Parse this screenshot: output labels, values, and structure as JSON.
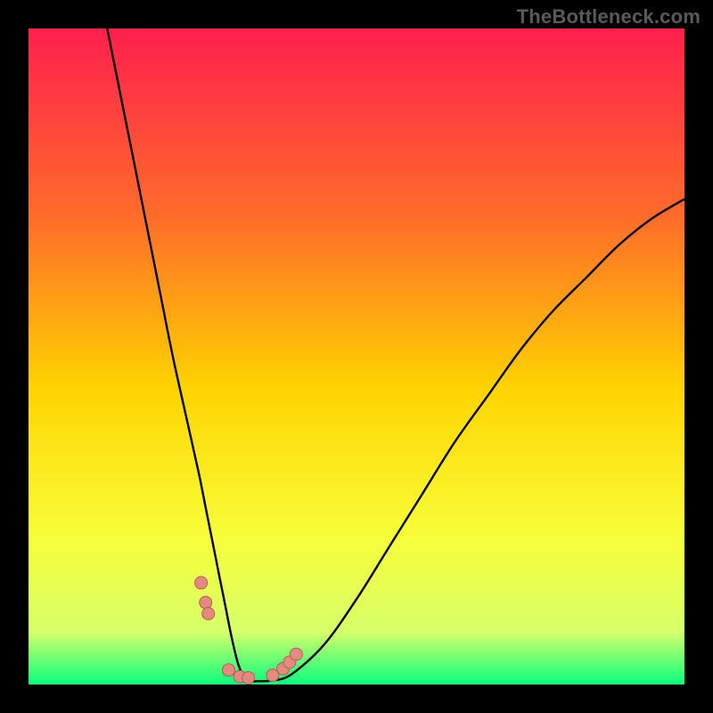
{
  "attribution": "TheBottleneck.com",
  "colors": {
    "frame": "#000000",
    "grad_top": "#ff1f4e",
    "grad_mid1": "#ff6a2a",
    "grad_mid2": "#ffd400",
    "grad_mid3": "#f7ff3a",
    "grad_low": "#d6ff6a",
    "grad_bottom": "#09ff7e",
    "curve": "#000000",
    "marker_fill": "#e58a80",
    "marker_stroke": "#b55a50"
  },
  "chart_data": {
    "type": "line",
    "title": "",
    "xlabel": "",
    "ylabel": "",
    "xlim": [
      0,
      100
    ],
    "ylim": [
      0,
      100
    ],
    "series": [
      {
        "name": "bottleneck-curve",
        "x": [
          12,
          14,
          16,
          18,
          20,
          22,
          24,
          26,
          27,
          28,
          29,
          30,
          31,
          32,
          33,
          34,
          35,
          37,
          40,
          45,
          50,
          55,
          60,
          65,
          70,
          75,
          80,
          85,
          90,
          95,
          100
        ],
        "y": [
          100,
          90,
          80,
          70,
          60,
          50,
          41,
          32,
          27,
          22,
          17,
          12,
          7,
          3,
          1,
          0.5,
          0.5,
          0.6,
          1.5,
          6,
          13,
          21,
          29,
          37,
          44,
          51,
          57,
          62,
          67,
          71,
          74
        ]
      }
    ],
    "markers": [
      {
        "x": 26.3,
        "y": 15.5
      },
      {
        "x": 27.0,
        "y": 12.5
      },
      {
        "x": 27.4,
        "y": 10.8
      },
      {
        "x": 30.5,
        "y": 2.2
      },
      {
        "x": 32.2,
        "y": 1.2
      },
      {
        "x": 33.5,
        "y": 1.0
      },
      {
        "x": 37.2,
        "y": 1.4
      },
      {
        "x": 38.8,
        "y": 2.4
      },
      {
        "x": 39.8,
        "y": 3.4
      },
      {
        "x": 40.8,
        "y": 4.6
      }
    ]
  }
}
